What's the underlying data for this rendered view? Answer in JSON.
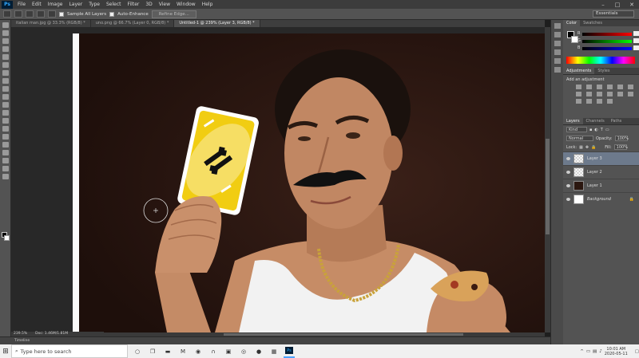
{
  "menubar": {
    "logo": "Ps",
    "items": [
      "File",
      "Edit",
      "Image",
      "Layer",
      "Type",
      "Select",
      "Filter",
      "3D",
      "View",
      "Window",
      "Help"
    ]
  },
  "options": {
    "sample_all_layers": "Sample All Layers",
    "auto_enhance": "Auto-Enhance",
    "refine_edge": "Refine Edge...",
    "workspace": "Essentials"
  },
  "tabs": [
    "italian man.jpg @ 33.3% (RGB/8) *",
    "uno.png @ 66.7% (Layer 0, RGB/8) *",
    "Untitled-1 @ 239% (Layer 3, RGB/8) *"
  ],
  "status": {
    "zoom": "239.5%",
    "doc": "Doc: 1.46M/1.81M"
  },
  "timeline": "Timeline",
  "color_panel": {
    "tabs": [
      "Color",
      "Swatches"
    ],
    "channels": [
      "R",
      "G",
      "B"
    ]
  },
  "adjustments": {
    "tabs": [
      "Adjustments",
      "Styles"
    ],
    "title": "Add an adjustment"
  },
  "layers_panel": {
    "tabs": [
      "Layers",
      "Channels",
      "Paths"
    ],
    "kind": "Kind",
    "blend_mode": "Normal",
    "opacity_label": "Opacity:",
    "opacity": "100%",
    "lock_label": "Lock:",
    "fill_label": "Fill:",
    "fill": "100%",
    "layers": [
      "Layer 3",
      "Layer 2",
      "Layer 1",
      "Background"
    ]
  },
  "taskbar": {
    "search_placeholder": "Type here to search",
    "time": "10:01 AM",
    "date": "2020-05-11"
  },
  "colors": {
    "card_yellow": "#f1cd12",
    "photo_bg": "#2a1813",
    "ps_blue": "#31a8ff",
    "selected_layer": "#6d7a8c"
  }
}
